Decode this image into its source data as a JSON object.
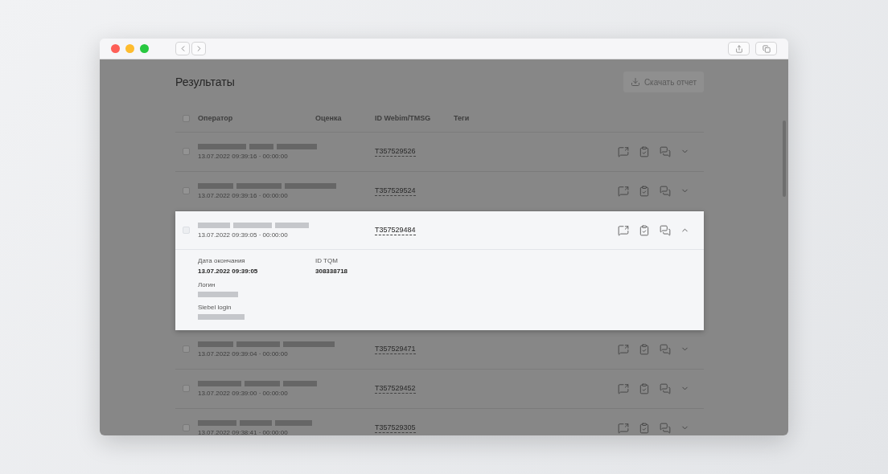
{
  "page": {
    "title": "Результаты",
    "download_button": "Скачать отчет"
  },
  "table": {
    "select_all": {
      "checked": false
    },
    "columns": [
      "Оператор",
      "Оценка",
      "ID Webim/TMSG",
      "Теги"
    ],
    "rows": [
      {
        "checked": false,
        "time": "13.07.2022 09:39:16 · 00:00:00",
        "id": "T357529526",
        "expanded": false
      },
      {
        "checked": false,
        "time": "13.07.2022 09:39:16 · 00:00:00",
        "id": "T357529524",
        "expanded": false
      },
      {
        "checked": false,
        "time": "13.07.2022 09:39:05 · 00:00:00",
        "id": "T357529484",
        "expanded": true,
        "details": [
          [
            {
              "label": "Дата окончания",
              "value": "13.07.2022 09:39:05"
            },
            {
              "label": "Логин"
            },
            {
              "label": "Siebel login"
            }
          ],
          [
            {
              "label": "ID TQM",
              "value": "308338718"
            }
          ]
        ]
      },
      {
        "checked": false,
        "time": "13.07.2022 09:39:04 · 00:00:00",
        "id": "T357529471",
        "expanded": false
      },
      {
        "checked": false,
        "time": "13.07.2022 09:39:00 · 00:00:00",
        "id": "T357529452",
        "expanded": false
      },
      {
        "checked": false,
        "time": "13.07.2022 09:38:41 · 00:00:00",
        "id": "T357529305",
        "expanded": false
      }
    ]
  }
}
